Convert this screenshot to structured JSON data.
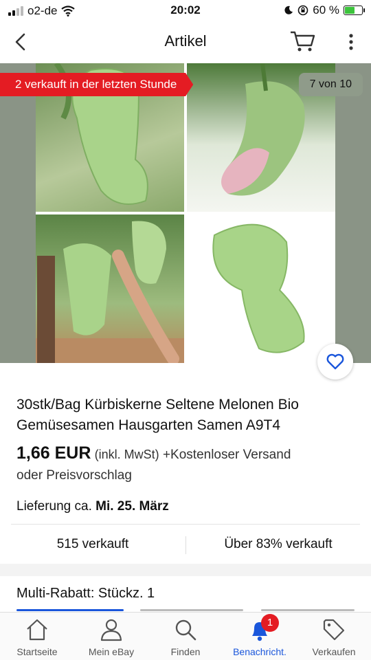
{
  "status_bar": {
    "carrier": "o2-de",
    "time": "20:02",
    "battery": "60 %"
  },
  "header": {
    "title": "Artikel"
  },
  "gallery": {
    "sold_badge": "2 verkauft in der letzten Stunde",
    "page_counter": "7 von 10"
  },
  "product": {
    "title": "30stk/Bag Kürbiskerne Seltene Melonen Bio Gemüsesamen Hausgarten Samen A9T4",
    "price": "1,66 EUR",
    "tax_note": "(inkl. MwSt)",
    "shipping": "+Kostenloser Versand",
    "offer": "oder Preisvorschlag",
    "delivery_prefix": "Lieferung ca.",
    "delivery_date": "Mi. 25. März"
  },
  "stats": {
    "sold": "515 verkauft",
    "sold_percent": "Über 83% verkauft"
  },
  "options": {
    "multi_discount": "Multi-Rabatt: Stückz. 1"
  },
  "tabbar": {
    "items": [
      {
        "label": "Startseite",
        "icon": "home-icon"
      },
      {
        "label": "Mein eBay",
        "icon": "user-icon"
      },
      {
        "label": "Finden",
        "icon": "search-icon"
      },
      {
        "label": "Benachricht.",
        "icon": "bell-icon",
        "badge": "1",
        "active": true
      },
      {
        "label": "Verkaufen",
        "icon": "tag-icon"
      }
    ]
  },
  "colors": {
    "accent": "#1a56db",
    "badge_red": "#e41c23",
    "battery_green": "#3cc43c"
  }
}
